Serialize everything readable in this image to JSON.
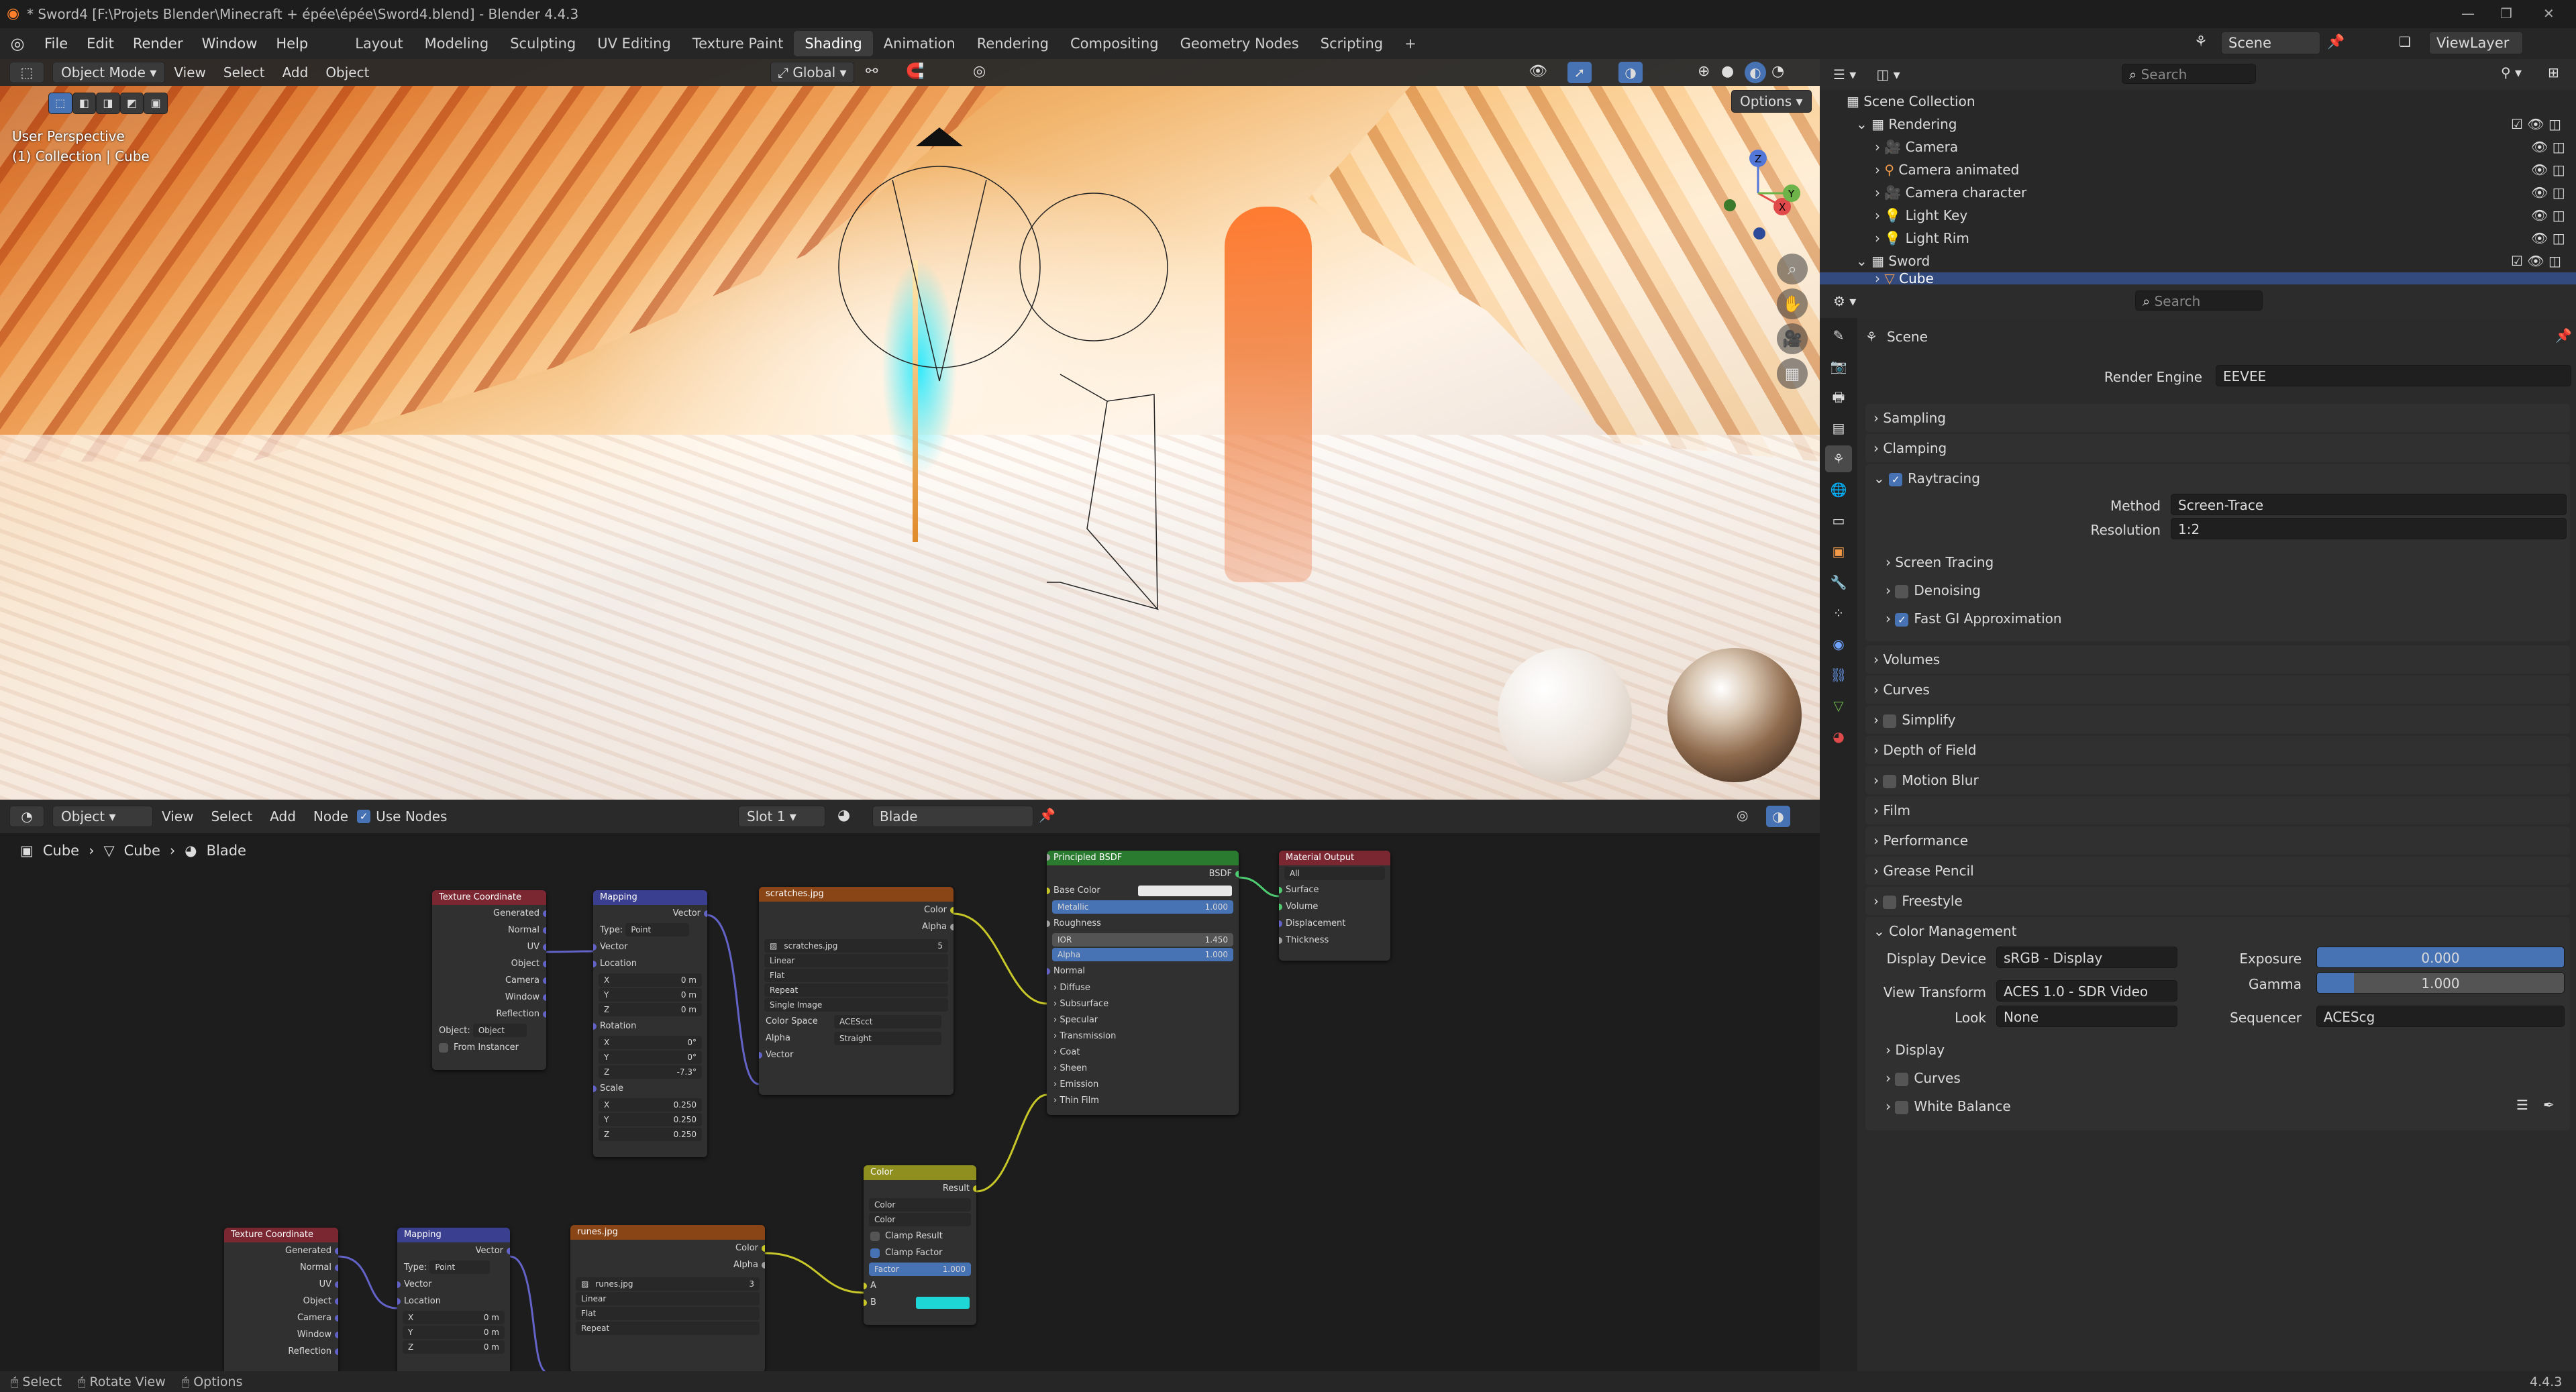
{
  "window": {
    "title": "* Sword4 [F:\\Projets Blender\\Minecraft + épée\\épée\\Sword4.blend] - Blender 4.4.3"
  },
  "menu": {
    "items": [
      "File",
      "Edit",
      "Render",
      "Window",
      "Help"
    ]
  },
  "workspaces": {
    "tabs": [
      "Layout",
      "Modeling",
      "Sculpting",
      "UV Editing",
      "Texture Paint",
      "Shading",
      "Animation",
      "Rendering",
      "Compositing",
      "Geometry Nodes",
      "Scripting"
    ],
    "active": "Shading",
    "add": "+"
  },
  "topright": {
    "scene": "Scene",
    "view_layer": "ViewLayer"
  },
  "viewport": {
    "mode": "Object Mode",
    "menus": [
      "View",
      "Select",
      "Add",
      "Object"
    ],
    "orientation": "Global",
    "options": "Options",
    "overlay_line1": "User Perspective",
    "overlay_line2": "(1) Collection | Cube",
    "gizmo_axes": [
      "Z",
      "X",
      "Y"
    ]
  },
  "node_editor": {
    "type_menu": "Object",
    "menus": [
      "View",
      "Select",
      "Add",
      "Node"
    ],
    "use_nodes": "Use Nodes",
    "slot": "Slot 1",
    "material": "Blade",
    "breadcrumb": [
      "Cube",
      "Cube",
      "Blade"
    ],
    "tex_coord": {
      "title": "Texture Coordinate",
      "outputs": [
        "Generated",
        "Normal",
        "UV",
        "Object",
        "Camera",
        "Window",
        "Reflection"
      ],
      "object_label": "Object:",
      "object_ph": "Object",
      "from_instancer": "From Instancer"
    },
    "mapping": {
      "title": "Mapping",
      "out": "Vector",
      "type_label": "Type:",
      "type": "Point",
      "vector": "Vector",
      "location": "Location",
      "loc": [
        "0 m",
        "0 m",
        "0 m"
      ],
      "rotation": "Rotation",
      "rot": [
        "0°",
        "0°",
        "-7.3°"
      ],
      "scale": "Scale",
      "scl": [
        "0.250",
        "0.250",
        "0.250"
      ],
      "axes": [
        "X",
        "Y",
        "Z"
      ]
    },
    "scratches": {
      "title": "scratches.jpg",
      "color": "Color",
      "alpha": "Alpha",
      "file": "scratches.jpg",
      "users": "5",
      "interp": "Linear",
      "proj": "Flat",
      "ext": "Repeat",
      "source": "Single Image",
      "cs_label": "Color Space",
      "cs": "ACEScct",
      "alpha_label": "Alpha",
      "alpha_mode": "Straight",
      "vector": "Vector"
    },
    "bsdf": {
      "title": "Principled BSDF",
      "out": "BSDF",
      "base_color": "Base Color",
      "metallic": "Metallic",
      "metallic_v": "1.000",
      "roughness": "Roughness",
      "ior": "IOR",
      "ior_v": "1.450",
      "alpha": "Alpha",
      "alpha_v": "1.000",
      "normal": "Normal",
      "subs": [
        "Diffuse",
        "Subsurface",
        "Specular",
        "Transmission",
        "Coat",
        "Sheen",
        "Emission",
        "Thin Film"
      ]
    },
    "output": {
      "title": "Material Output",
      "target": "All",
      "inputs": [
        "Surface",
        "Volume",
        "Displacement",
        "Thickness"
      ]
    },
    "mix": {
      "title": "Color",
      "result": "Result",
      "blend": "Color",
      "dtype": "Color",
      "clamp_result": "Clamp Result",
      "clamp_factor": "Clamp Factor",
      "factor": "Factor",
      "factor_v": "1.000",
      "a": "A",
      "b": "B",
      "b_color": "#1fd6d6"
    },
    "tex_coord2": {
      "title": "Texture Coordinate"
    },
    "mapping2": {
      "title": "Mapping"
    },
    "runes": {
      "title": "runes.jpg",
      "file": "runes.jpg",
      "users": "3",
      "interp": "Linear",
      "proj": "Flat",
      "ext": "Repeat"
    }
  },
  "outliner": {
    "search": "Search",
    "root": "Scene Collection",
    "items": [
      {
        "label": "Rendering"
      },
      {
        "label": "Camera"
      },
      {
        "label": "Camera animated"
      },
      {
        "label": "Camera character"
      },
      {
        "label": "Light Key"
      },
      {
        "label": "Light Rim"
      },
      {
        "label": "Sword"
      },
      {
        "label": "Cube"
      }
    ]
  },
  "properties": {
    "search": "Search",
    "context": "Scene",
    "render_engine_label": "Render Engine",
    "render_engine": "EEVEE",
    "panels": [
      "Sampling",
      "Clamping",
      "Raytracing",
      "Volumes",
      "Curves",
      "Simplify",
      "Depth of Field",
      "Motion Blur",
      "Film",
      "Performance",
      "Grease Pencil",
      "Freestyle",
      "Color Management"
    ],
    "raytracing": {
      "method_label": "Method",
      "method": "Screen-Trace",
      "resolution_label": "Resolution",
      "resolution": "1:2",
      "sub": [
        "Screen Tracing",
        "Denoising",
        "Fast GI Approximation"
      ]
    },
    "color_mgmt": {
      "display_device_label": "Display Device",
      "display_device": "sRGB - Display",
      "view_transform_label": "View Transform",
      "view_transform": "ACES 1.0 - SDR Video",
      "look_label": "Look",
      "look": "None",
      "exposure_label": "Exposure",
      "exposure": "0.000",
      "gamma_label": "Gamma",
      "gamma": "1.000",
      "sequencer_label": "Sequencer",
      "sequencer": "ACEScg",
      "sub": [
        "Display",
        "Curves",
        "White Balance"
      ]
    }
  },
  "statusbar": {
    "items": [
      "Select",
      "Rotate View",
      "Options"
    ],
    "version": "4.4.3"
  },
  "colors": {
    "accent": "#4772b3",
    "selection": "#334a7e"
  }
}
